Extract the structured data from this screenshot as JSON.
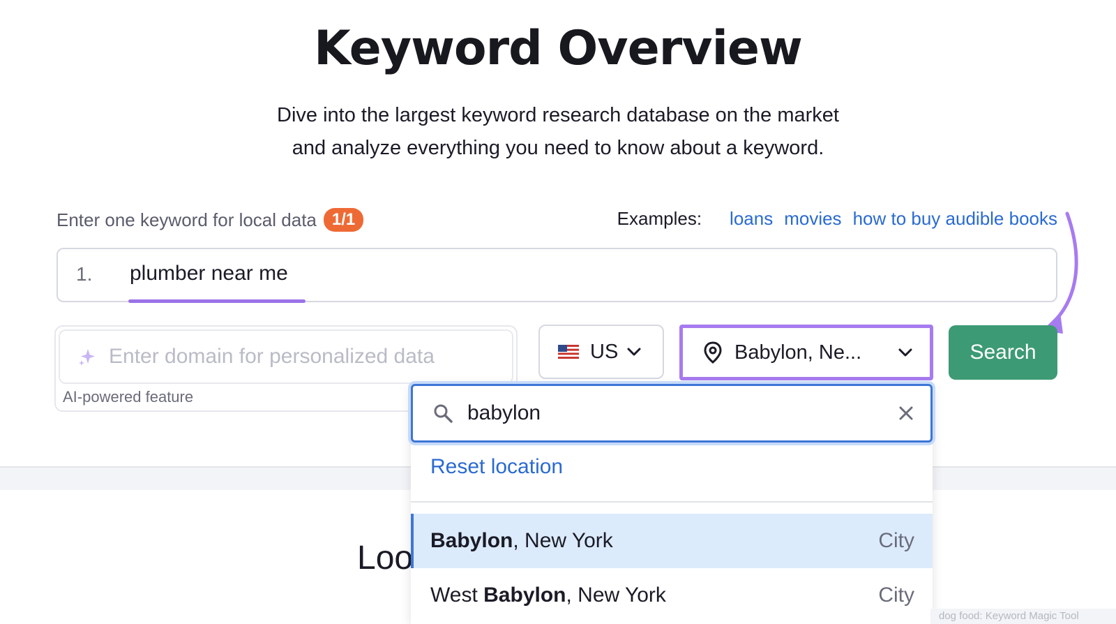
{
  "header": {
    "title": "Keyword Overview",
    "subtitle_line1": "Dive into the largest keyword research database on the market",
    "subtitle_line2": "and analyze everything you need to know about a keyword."
  },
  "keyword": {
    "label": "Enter one keyword for local data",
    "badge": "1/1",
    "number": "1.",
    "value": "plumber near me"
  },
  "examples": {
    "label": "Examples:",
    "links": [
      "loans",
      "movies",
      "how to buy audible books"
    ]
  },
  "domain": {
    "placeholder": "Enter domain for personalized data",
    "caption": "AI-powered feature"
  },
  "country": {
    "value": "US",
    "icon": "us-flag-icon"
  },
  "location": {
    "value": "Babylon, Ne...",
    "icon": "location-pin-icon"
  },
  "search_button": {
    "label": "Search"
  },
  "dropdown": {
    "search_value": "babylon",
    "reset_label": "Reset location",
    "items": [
      {
        "prefix": "",
        "bold": "Babylon",
        "suffix": ", New York",
        "type": "City",
        "selected": true
      },
      {
        "prefix": "West ",
        "bold": "Babylon",
        "suffix": ", New York",
        "type": "City",
        "selected": false
      }
    ]
  },
  "section": {
    "heading_partial": "Loo"
  },
  "watermark": "dog food: Keyword Magic Tool",
  "colors": {
    "accent_purple": "#a77bf0",
    "link_blue": "#2a6ad1",
    "search_green": "#3c9a74",
    "badge_orange": "#ee6a35"
  }
}
